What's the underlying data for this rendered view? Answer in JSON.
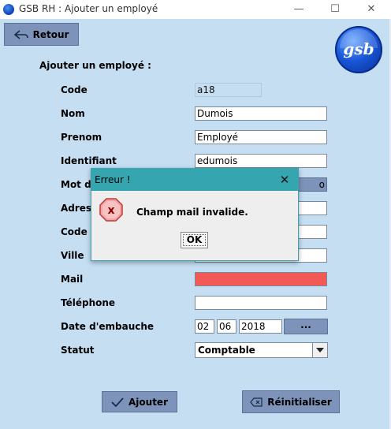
{
  "window": {
    "title": "GSB RH : Ajouter un employé",
    "minimize": "—",
    "maximize": "☐",
    "close": "✕"
  },
  "toolbar": {
    "back_label": "Retour"
  },
  "logo": {
    "text": "gsb"
  },
  "form": {
    "section_title": "Ajouter un employé :",
    "labels": {
      "code": "Code",
      "nom": "Nom",
      "prenom": "Prenom",
      "identifiant": "Identifiant",
      "mdp": "Mot de",
      "adresse": "Adress",
      "code_postal": "Code P",
      "ville": "Ville",
      "mail": "Mail",
      "telephone": "Téléphone",
      "date_embauche": "Date d'embauche",
      "statut": "Statut"
    },
    "values": {
      "code": "a18",
      "nom": "Dumois",
      "prenom": "Employé",
      "identifiant": "edumois",
      "mdp_suffix": "o",
      "adresse": "",
      "code_postal": "",
      "ville": "",
      "mail": "",
      "telephone": ""
    },
    "date": {
      "day": "02",
      "month": "06",
      "year": "2018",
      "picker_label": "..."
    },
    "statut": {
      "selected": "Comptable"
    }
  },
  "actions": {
    "add_label": "Ajouter",
    "reset_label": "Réinitialiser"
  },
  "dialog": {
    "title": "Erreur !",
    "close": "✕",
    "message": "Champ mail invalide.",
    "ok_label": "OK",
    "icon_glyph": "x"
  },
  "colors": {
    "background": "#c5def2",
    "button": "#7d93b9",
    "mail_error": "#f25a56",
    "dialog_titlebar": "#35a6b0"
  }
}
